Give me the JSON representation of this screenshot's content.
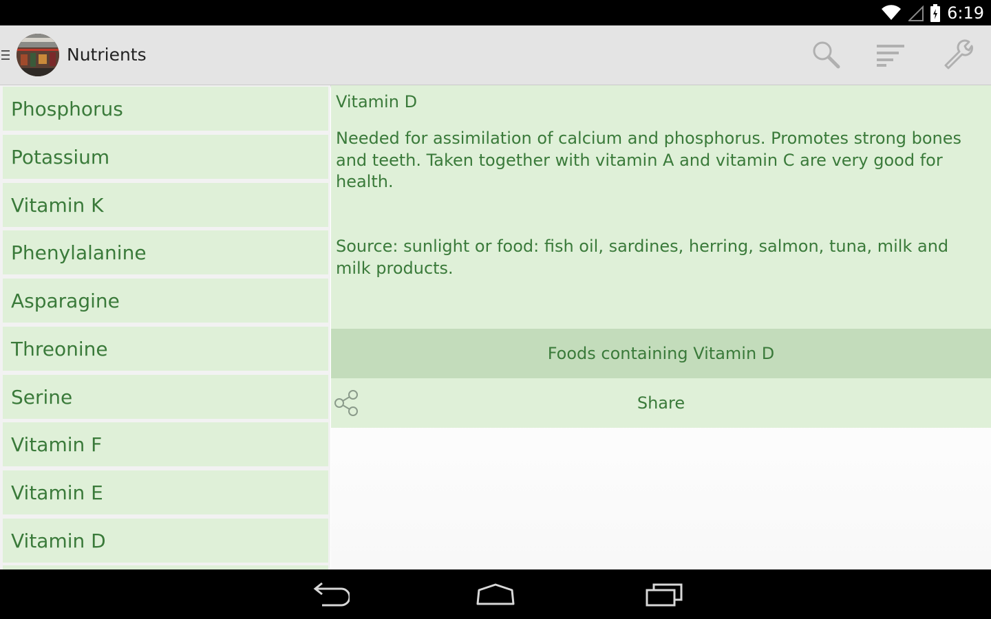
{
  "status_bar": {
    "time": "6:19",
    "icons": [
      "wifi-icon",
      "signal-icon",
      "battery-icon"
    ]
  },
  "action_bar": {
    "title": "Nutrients",
    "icons": [
      "search-icon",
      "sort-icon",
      "settings-wrench-icon"
    ]
  },
  "nutrient_list": {
    "items": [
      {
        "label": "Phosphorus"
      },
      {
        "label": "Potassium"
      },
      {
        "label": "Vitamin K"
      },
      {
        "label": "Phenylalanine"
      },
      {
        "label": "Asparagine"
      },
      {
        "label": "Threonine"
      },
      {
        "label": "Serine"
      },
      {
        "label": "Vitamin F"
      },
      {
        "label": "Vitamin E"
      },
      {
        "label": "Vitamin D"
      }
    ]
  },
  "detail": {
    "title": "Vitamin D",
    "description": "Needed for assimilation of calcium and phosphorus. Promotes strong bones and teeth. Taken together with vitamin A and vitamin C are very good for health.",
    "source": "Source: sunlight or food: fish oil, sardines, herring, salmon, tuna, milk and milk products.",
    "foods_button": "Foods containing Vitamin D",
    "share_button": "Share"
  },
  "nav_bar": {
    "icons": [
      "back-icon",
      "home-icon",
      "recent-apps-icon"
    ]
  },
  "colors": {
    "list_bg": "#dff0d8",
    "text_green": "#3a7a3a",
    "button_bg": "#c3dcbb",
    "actionbar_bg": "#e4e4e4"
  }
}
